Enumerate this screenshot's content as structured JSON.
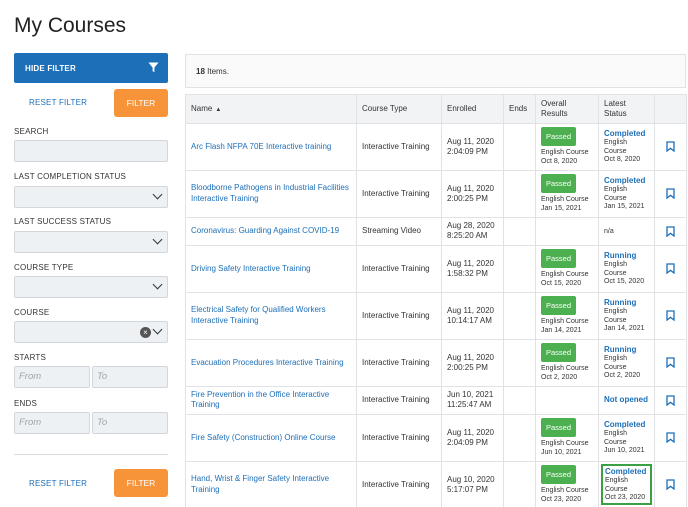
{
  "page_title": "My Courses",
  "sidebar": {
    "hide_filter_label": "HIDE FILTER",
    "reset_filter_label": "RESET FILTER",
    "filter_label": "FILTER",
    "search_label": "SEARCH",
    "last_completion_status_label": "LAST COMPLETION STATUS",
    "last_success_status_label": "LAST SUCCESS STATUS",
    "course_type_label": "COURSE TYPE",
    "course_label": "COURSE",
    "starts_label": "STARTS",
    "ends_label": "ENDS",
    "from_placeholder": "From",
    "to_placeholder": "To",
    "clear_glyph": "×"
  },
  "items": {
    "count": "18",
    "suffix": "Items."
  },
  "table": {
    "headers": {
      "name": "Name",
      "course_type": "Course Type",
      "enrolled": "Enrolled",
      "ends": "Ends",
      "overall_results": "Overall Results",
      "latest_status": "Latest Status"
    },
    "sort_glyph": "▲",
    "rows": [
      {
        "name": "Arc Flash NFPA 70E Interactive training",
        "type": "Interactive Training",
        "enrolled_date": "Aug 11, 2020",
        "enrolled_time": "2:04:09 PM",
        "ends": "",
        "result": "Passed",
        "result_sub1": "English Course",
        "result_sub2": "Oct 8, 2020",
        "status": "Completed",
        "status_sub1": "English",
        "status_sub2": "Course",
        "status_sub3": "Oct 8, 2020"
      },
      {
        "name": "Bloodborne Pathogens in Industrial Facilities Interactive Training",
        "type": "Interactive Training",
        "enrolled_date": "Aug 11, 2020",
        "enrolled_time": "2:00:25 PM",
        "ends": "",
        "result": "Passed",
        "result_sub1": "English Course",
        "result_sub2": "Jan 15, 2021",
        "status": "Completed",
        "status_sub1": "English",
        "status_sub2": "Course",
        "status_sub3": "Jan 15, 2021"
      },
      {
        "name": "Coronavirus: Guarding Against COVID-19",
        "type": "Streaming Video",
        "enrolled_date": "Aug 28, 2020",
        "enrolled_time": "8:25:20 AM",
        "ends": "",
        "result": "",
        "result_sub1": "",
        "result_sub2": "",
        "status": "",
        "status_plain": "n/a",
        "status_sub1": "",
        "status_sub2": "",
        "status_sub3": ""
      },
      {
        "name": "Driving Safety Interactive Training",
        "type": "Interactive Training",
        "enrolled_date": "Aug 11, 2020",
        "enrolled_time": "1:58:32 PM",
        "ends": "",
        "result": "Passed",
        "result_sub1": "English Course",
        "result_sub2": "Oct 15, 2020",
        "status": "Running",
        "status_sub1": "English",
        "status_sub2": "Course",
        "status_sub3": "Oct 15, 2020"
      },
      {
        "name": "Electrical Safety for Qualified Workers Interactive Training",
        "type": "Interactive Training",
        "enrolled_date": "Aug 11, 2020",
        "enrolled_time": "10:14:17 AM",
        "ends": "",
        "result": "Passed",
        "result_sub1": "English Course",
        "result_sub2": "Jan 14, 2021",
        "status": "Running",
        "status_sub1": "English",
        "status_sub2": "Course",
        "status_sub3": "Jan 14, 2021"
      },
      {
        "name": "Evacuation Procedures Interactive Training",
        "type": "Interactive Training",
        "enrolled_date": "Aug 11, 2020",
        "enrolled_time": "2:00:25 PM",
        "ends": "",
        "result": "Passed",
        "result_sub1": "English Course",
        "result_sub2": "Oct 2, 2020",
        "status": "Running",
        "status_sub1": "English",
        "status_sub2": "Course",
        "status_sub3": "Oct 2, 2020"
      },
      {
        "name": "Fire Prevention in the Office Interactive Training",
        "type": "Interactive Training",
        "enrolled_date": "Jun 10, 2021",
        "enrolled_time": "11:25:47 AM",
        "ends": "",
        "result": "",
        "result_sub1": "",
        "result_sub2": "",
        "status": "Not opened",
        "status_sub1": "",
        "status_sub2": "",
        "status_sub3": ""
      },
      {
        "name": "Fire Safety (Construction) Online Course",
        "type": "Interactive Training",
        "enrolled_date": "Aug 11, 2020",
        "enrolled_time": "2:04:09 PM",
        "ends": "",
        "result": "Passed",
        "result_sub1": "English Course",
        "result_sub2": "Jun 10, 2021",
        "status": "Completed",
        "status_sub1": "English",
        "status_sub2": "Course",
        "status_sub3": "Jun 10, 2021"
      },
      {
        "name": "Hand, Wrist & Finger Safety Interactive Training",
        "type": "Interactive Training",
        "enrolled_date": "Aug 10, 2020",
        "enrolled_time": "5:17:07 PM",
        "ends": "",
        "result": "Passed",
        "result_sub1": "English Course",
        "result_sub2": "Oct 23, 2020",
        "status": "Completed",
        "status_sub1": "English",
        "status_sub2": "Course",
        "status_sub3": "Oct 23, 2020",
        "highlight": true
      }
    ]
  },
  "colors": {
    "primary": "#1d6fb8",
    "accent": "#f7943a",
    "success": "#4caf50",
    "highlight": "#3aa045"
  }
}
